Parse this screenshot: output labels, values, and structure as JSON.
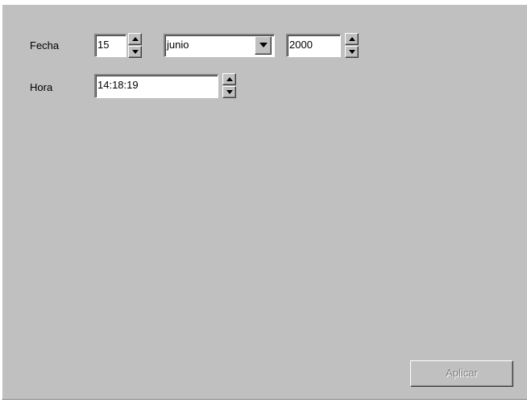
{
  "form": {
    "fecha_label": "Fecha",
    "hora_label": "Hora",
    "day_value": "15",
    "month_value": "junio",
    "year_value": "2000",
    "time_value": "14:18:19"
  },
  "buttons": {
    "apply_label": "Aplicar",
    "apply_enabled": false
  },
  "colors": {
    "panel_bg": "#c0c0c0",
    "disabled_text": "#808080"
  }
}
